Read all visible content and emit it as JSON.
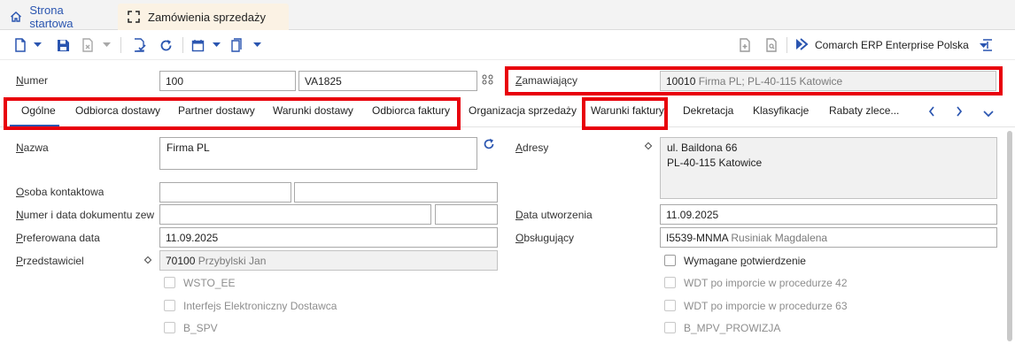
{
  "app_tabs": [
    {
      "label": "Strona startowa",
      "icon": "home-icon"
    },
    {
      "label": "Zamówienia sprzedaży",
      "icon": "expand-icon"
    }
  ],
  "toolbar": {
    "company": "Comarch ERP Enterprise Polska"
  },
  "header": {
    "numer_label_first": "N",
    "numer_label_rest": "umer",
    "numer_value": "100",
    "numer_code": "VA1825",
    "zamawiajacy_label_first": "Z",
    "zamawiajacy_label_rest": "amawiający",
    "zamawiajacy_code": "10010",
    "zamawiajacy_desc": "Firma PL; PL-40-115 Katowice"
  },
  "form_tabs": [
    "Ogólne",
    "Odbiorca dostawy",
    "Partner dostawy",
    "Warunki dostawy",
    "Odbiorca faktury",
    "Organizacja sprzedaży",
    "Warunki faktury",
    "Dekretacja",
    "Klasyfikacje",
    "Rabaty zlece..."
  ],
  "form": {
    "nazwa_label_first": "N",
    "nazwa_label_rest": "azwa",
    "nazwa_value": "Firma PL",
    "adresy_label_first": "A",
    "adresy_label_rest": "dresy",
    "adresy_line1": "ul. Baildona 66",
    "adresy_line2": "PL-40-115 Katowice",
    "osoba_label_first": "O",
    "osoba_label_rest": "soba kontaktowa",
    "numer_dok_label_first": "N",
    "numer_dok_label_rest": "umer i data dokumentu zew...",
    "data_utw_label_first": "D",
    "data_utw_label_rest": "ata utworzenia",
    "data_utw_value": "11.09.2025",
    "pref_label_first": "P",
    "pref_label_rest": "referowana data",
    "pref_value": "11.09.2025",
    "obsl_label_first": "O",
    "obsl_label_rest": "bsługujący",
    "obsl_code": "I5539-MNMA",
    "obsl_name": "Rusiniak Magdalena",
    "przed_label_first": "P",
    "przed_label_rest": "rzedstawiciel",
    "przed_code": "70100",
    "przed_name": "Przybylski Jan"
  },
  "checkboxes_left": [
    "WSTO_EE",
    "Interfejs Elektroniczny Dostawca",
    "B_SPV"
  ],
  "checkboxes_right": {
    "wymagane_first": "Wymagane ",
    "wymagane_u": "p",
    "wymagane_rest": "otwierdzenie",
    "items": [
      "WDT po imporcie w procedurze 42",
      "WDT po imporcie w procedurze 63",
      "B_MPV_PROWIZJA"
    ]
  }
}
